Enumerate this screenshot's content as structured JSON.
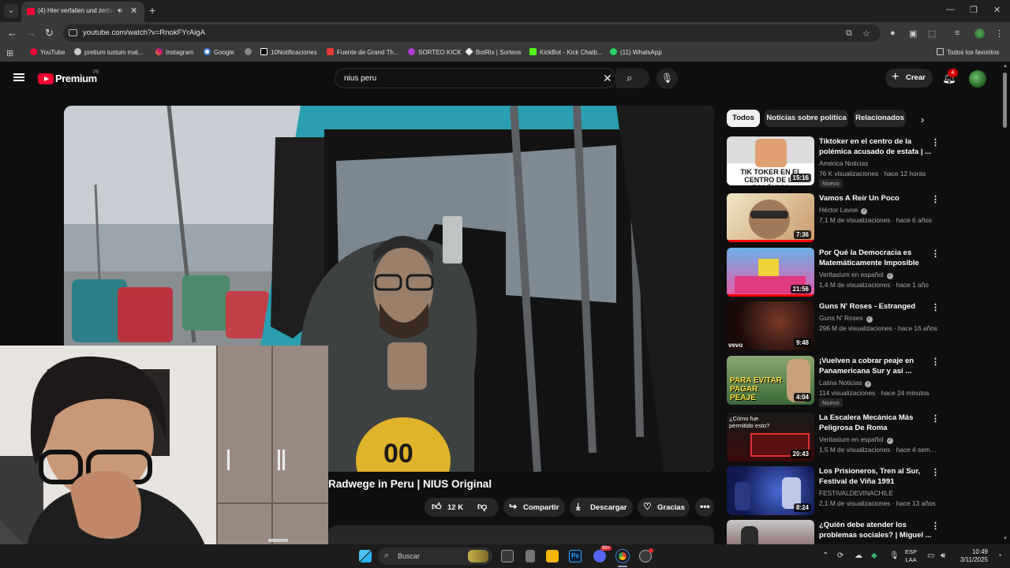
{
  "browser": {
    "tab_title": "(4) Hier verfallen und zerbröseln",
    "url": "youtube.com/watch?v=RnokFYrAigA",
    "bookmarks": [
      "YouTube",
      "pretium iustum mat...",
      "Instagram",
      "Google",
      "",
      "10Notificaciones",
      "Fuente de Grand Th...",
      "SORTEO KICK",
      "BotRix | Sorteos",
      "KickBot - Kick Chatb...",
      "(11) WhatsApp"
    ],
    "all_bookmarks": "Todos los favoritos"
  },
  "youtube": {
    "brand": "Premium",
    "region": "PE",
    "search_query": "nius peru",
    "create_label": "Crear",
    "notifications_count": "4",
    "video_title": "Radwege in Peru | NIUS Original",
    "likes": "12 K",
    "share_label": "Compartir",
    "download_label": "Descargar",
    "thanks_label": "Gracias",
    "chips": [
      "Todos",
      "Noticias sobre política",
      "Relacionados"
    ],
    "recommendations": [
      {
        "title": "Tiktoker en el centro de la polémica acusado de estafa | ...",
        "channel": "América Noticias",
        "meta": "76 K visualizaciones · hace 12 horas",
        "duration": "15:16",
        "badge": "Nuevo",
        "thumb_text": "TIK TOKER EN EL CENTRO DE LA POLÉMICA",
        "verified": false
      },
      {
        "title": "Vamos A Reír Un Poco",
        "channel": "Héctor Lavoe",
        "meta": "7,1 M de visualizaciones · hace 6 años",
        "duration": "7:36",
        "badge": "",
        "thumb_text": "",
        "verified": true,
        "progress": 1.0
      },
      {
        "title": "Por Qué la Democracia es Matemáticamente Imposible",
        "channel": "Veritasium en español",
        "meta": "1,4 M de visualizaciones · hace 1 año",
        "duration": "21:56",
        "badge": "",
        "thumb_text": "",
        "verified": true,
        "progress": 1.0
      },
      {
        "title": "Guns N' Roses - Estranged",
        "channel": "Guns N' Roses",
        "meta": "296 M de visualizaciones · hace 16 años",
        "duration": "9:48",
        "badge": "",
        "thumb_text": "vevo",
        "verified": true
      },
      {
        "title": "¡Vuelven a cobrar peaje en Panamericana Sur y así ...",
        "channel": "Latina Noticias",
        "meta": "114 visualizaciones · hace 24 minutos",
        "duration": "4:04",
        "badge": "Nuevo",
        "thumb_text": "PARA EVITAR PAGAR PEAJE",
        "verified": true
      },
      {
        "title": "La Escalera Mecánica Más Peligrosa De Roma",
        "channel": "Veritasium en español",
        "meta": "1,5 M de visualizaciones · hace 4 semanas",
        "duration": "20:43",
        "badge": "",
        "thumb_text": "¿Cómo fue permitido esto?",
        "verified": true
      },
      {
        "title": "Los Prisioneros, Tren al Sur, Festival de Viña 1991",
        "channel": "FESTIVALDEVINACHILE",
        "meta": "2,1 M de visualizaciones · hace 13 años",
        "duration": "8:24",
        "badge": "",
        "thumb_text": "",
        "verified": false
      },
      {
        "title": "¿Quién debe atender los problemas sociales? | Miguel ...",
        "channel": "",
        "meta": "",
        "duration": "",
        "badge": "",
        "thumb_text": "",
        "verified": false
      }
    ]
  },
  "taskbar": {
    "search_placeholder": "Buscar",
    "lang_line1": "ESP",
    "lang_line2": "LAA",
    "time": "10:49",
    "date": "3/11/2025",
    "discord_badge": "99+"
  },
  "colors": {
    "accent": "#ff0033",
    "background": "#0f0f0f",
    "chip": "#272727",
    "chrome": "#3a3a3a"
  }
}
